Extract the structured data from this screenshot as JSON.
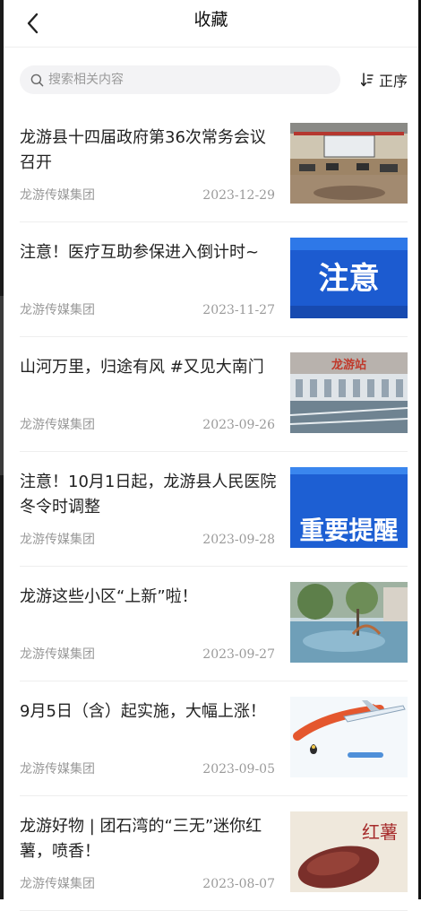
{
  "header": {
    "title": "收藏"
  },
  "search": {
    "placeholder": "搜索相关内容"
  },
  "sort": {
    "label": "正序"
  },
  "items": [
    {
      "title": "龙游县十四届政府第36次常务会议召开",
      "source": "龙游传媒集团",
      "date": "2023-12-29",
      "thumb": "meeting-room"
    },
    {
      "title": "注意！医疗互助参保进入倒计时~",
      "source": "龙游传媒集团",
      "date": "2023-11-27",
      "thumb": "notice-banner",
      "thumb_text": "注意"
    },
    {
      "title": "山河万里，归途有风 #又见大南门",
      "source": "龙游传媒集团",
      "date": "2023-09-26",
      "thumb": "station-building",
      "thumb_text": "龙游站"
    },
    {
      "title": "注意！10月1日起，龙游县人民医院冬令时调整",
      "source": "龙游传媒集团",
      "date": "2023-09-28",
      "thumb": "important-banner",
      "thumb_text": "重要提醒"
    },
    {
      "title": "龙游这些小区“上新”啦！",
      "source": "龙游传媒集团",
      "date": "2023-09-27",
      "thumb": "residential-plaza"
    },
    {
      "title": "9月5日（含）起实施，大幅上涨！",
      "source": "龙游传媒集团",
      "date": "2023-09-05",
      "thumb": "airplane-fuel"
    },
    {
      "title": "龙游好物 | 团石湾的“三无”迷你红薯，喷香！",
      "source": "龙游传媒集团",
      "date": "2023-08-07",
      "thumb": "sweet-potato",
      "thumb_text": "红薯"
    }
  ],
  "colors": {
    "accent": "#1f5fd6",
    "text": "#222222",
    "meta": "#9a9a9a"
  }
}
